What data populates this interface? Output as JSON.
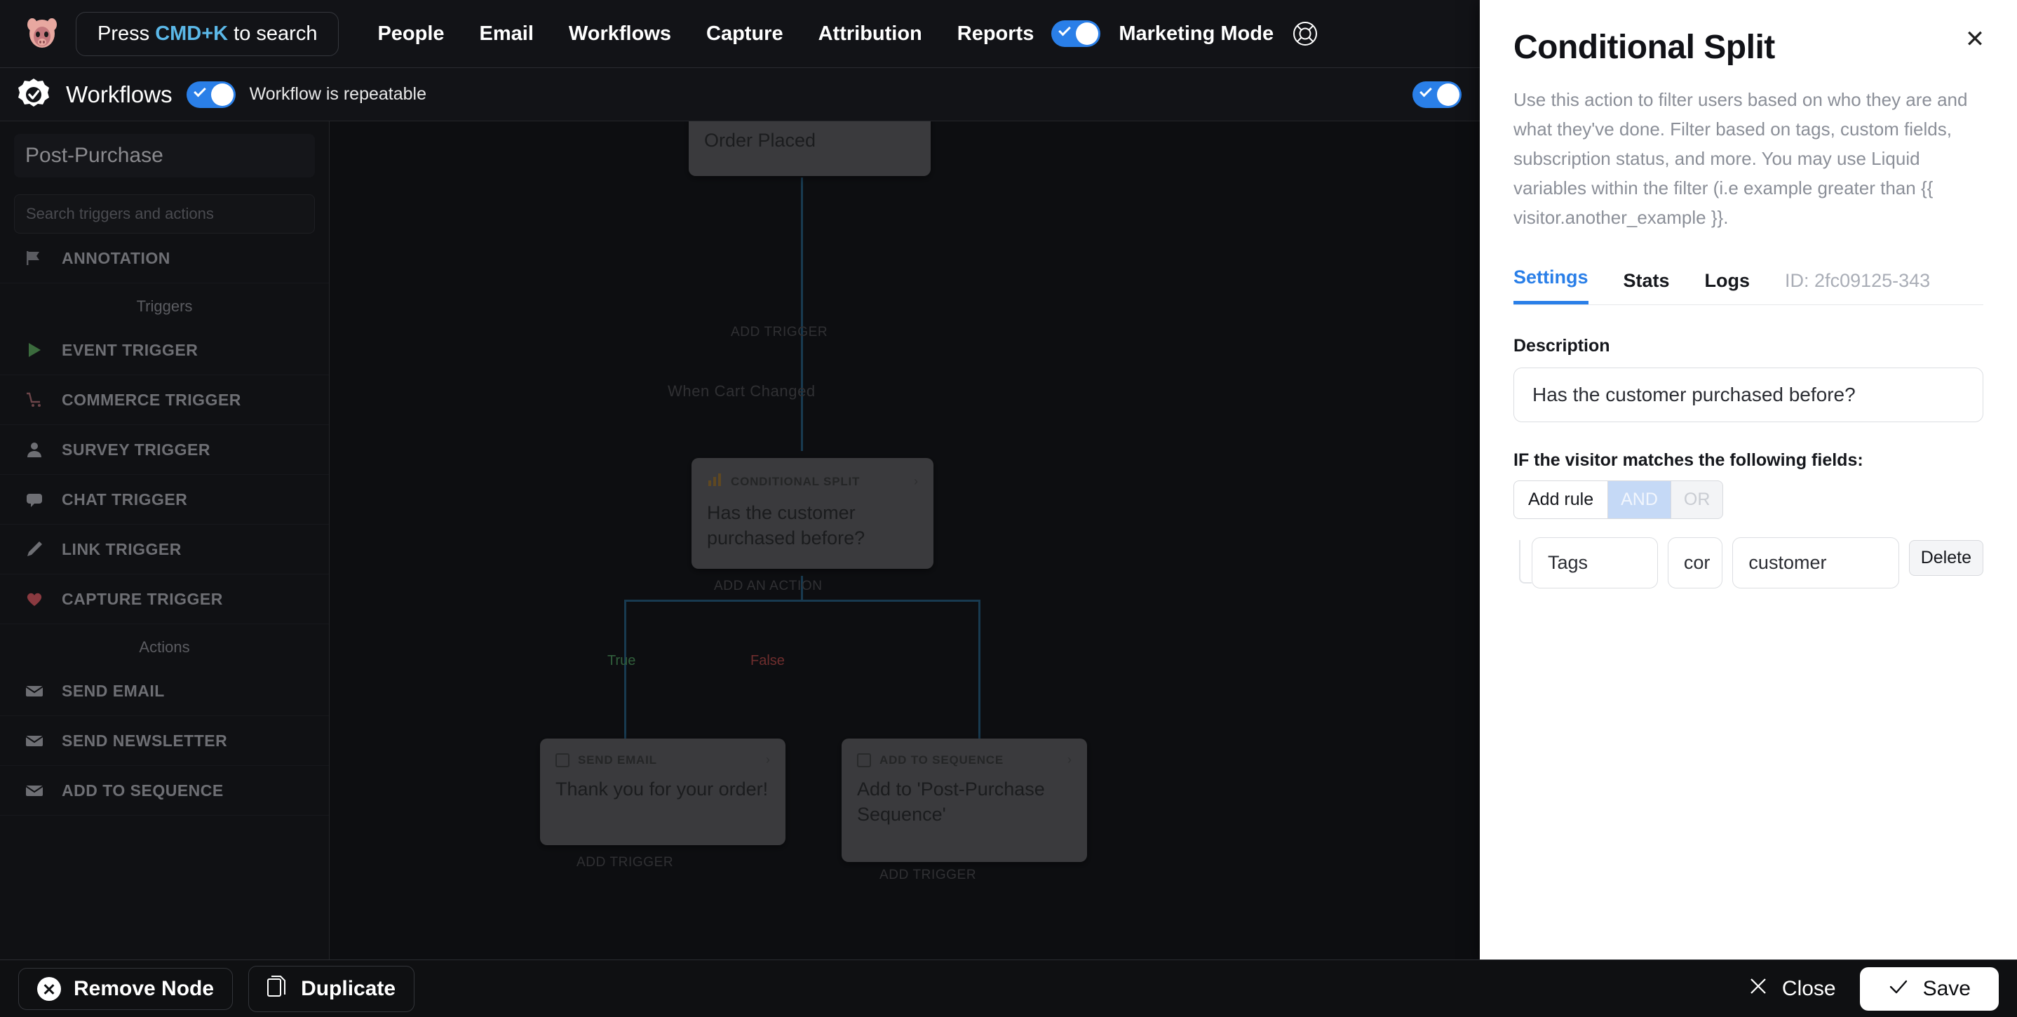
{
  "topnav": {
    "logo_icon": "pig-logo-icon",
    "search_prefix": "Press ",
    "search_kbd": "CMD+K",
    "search_suffix": " to search",
    "items": [
      {
        "label": "People"
      },
      {
        "label": "Email"
      },
      {
        "label": "Workflows"
      },
      {
        "label": "Capture"
      },
      {
        "label": "Attribution"
      },
      {
        "label": "Reports"
      }
    ],
    "marketing_mode_label": "Marketing Mode",
    "marketing_mode_on": true,
    "help_icon": "lifebuoy-icon"
  },
  "subheader": {
    "icon": "workflow-gear-check-icon",
    "title": "Workflows",
    "repeatable_label": "Workflow is repeatable",
    "repeatable_on": true,
    "right_toggle_on": true
  },
  "sidebar": {
    "workflow_name": "Post-Purchase",
    "search_placeholder": "Search triggers and actions",
    "annotation": {
      "label": "ANNOTATION",
      "icon": "flag-icon"
    },
    "triggers_group": "Triggers",
    "triggers": [
      {
        "label": "EVENT TRIGGER",
        "icon": "play-icon"
      },
      {
        "label": "COMMERCE TRIGGER",
        "icon": "cart-icon"
      },
      {
        "label": "SURVEY TRIGGER",
        "icon": "person-icon"
      },
      {
        "label": "CHAT TRIGGER",
        "icon": "chat-bubble-icon"
      },
      {
        "label": "LINK TRIGGER",
        "icon": "pencil-icon"
      },
      {
        "label": "CAPTURE TRIGGER",
        "icon": "heart-icon"
      }
    ],
    "actions_group": "Actions",
    "actions": [
      {
        "label": "SEND EMAIL",
        "icon": "envelope-icon"
      },
      {
        "label": "SEND NEWSLETTER",
        "icon": "envelope-icon"
      },
      {
        "label": "ADD TO SEQUENCE",
        "icon": "envelope-icon"
      }
    ]
  },
  "canvas": {
    "nodes": [
      {
        "title": "Order Placed",
        "kind": "",
        "icon": ""
      },
      {
        "title": "Has the customer purchased before?",
        "kind": "CONDITIONAL SPLIT",
        "icon": "split-icon"
      },
      {
        "title": "Thank you for your order!",
        "kind": "SEND EMAIL",
        "icon": "envelope-icon"
      },
      {
        "title": "Add to 'Post-Purchase Sequence'",
        "kind": "ADD TO SEQUENCE",
        "icon": "envelope-icon"
      }
    ],
    "add_trigger_label": "ADD TRIGGER",
    "cart_trigger_label": "When Cart Changed",
    "add_action_label": "ADD AN ACTION",
    "add_trigger_bottom_left": "ADD TRIGGER",
    "add_trigger_bottom_right": "ADD TRIGGER",
    "branch_true": "True",
    "branch_false": "False"
  },
  "panel": {
    "title": "Conditional Split",
    "description": "Use this action to filter users based on who they are and what they've done. Filter based on tags, custom fields, subscription status, and more. You may use Liquid variables within the filter (i.e example greater than {{ visitor.another_example }}.",
    "close_icon": "close-icon",
    "tabs": [
      {
        "label": "Settings",
        "active": true
      },
      {
        "label": "Stats",
        "active": false
      },
      {
        "label": "Logs",
        "active": false
      }
    ],
    "id_text": "ID: 2fc09125-343",
    "description_label": "Description",
    "description_value": "Has the customer purchased before?",
    "if_label": "IF the visitor matches the following fields:",
    "add_rule_label": "Add rule",
    "and_label": "AND",
    "or_label": "OR",
    "logic_selected": "AND",
    "rule": {
      "field": "Tags",
      "operator": "cor",
      "value": "customer",
      "delete_label": "Delete"
    },
    "accent_color": "#2a7fe8"
  },
  "bottombar": {
    "remove_node_label": "Remove Node",
    "duplicate_label": "Duplicate",
    "close_label": "Close",
    "save_label": "Save"
  }
}
